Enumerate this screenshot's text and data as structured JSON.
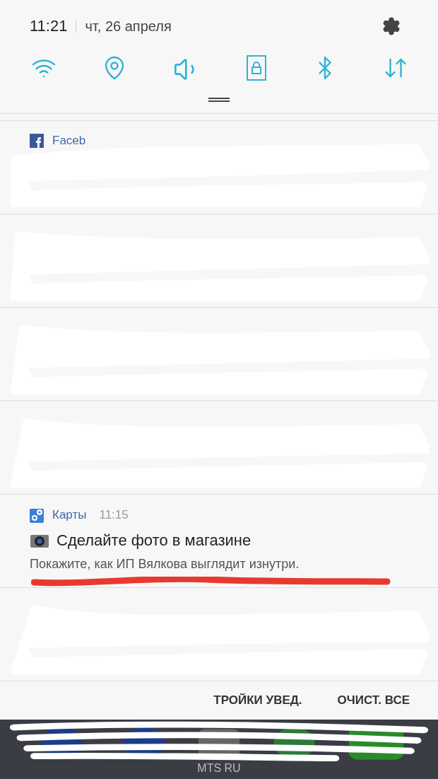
{
  "status": {
    "time": "11:21",
    "date": "чт, 26 апреля"
  },
  "quick_toggles": [
    {
      "kind": "wifi",
      "on": true
    },
    {
      "kind": "location",
      "on": true
    },
    {
      "kind": "sound",
      "on": true
    },
    {
      "kind": "rotation_lock",
      "on": true
    },
    {
      "kind": "bluetooth",
      "on": true
    },
    {
      "kind": "data",
      "on": true
    }
  ],
  "notifications": [
    {
      "kind": "redacted",
      "app": "Faceb"
    },
    {
      "kind": "redacted"
    },
    {
      "kind": "redacted"
    },
    {
      "kind": "redacted"
    },
    {
      "kind": "message",
      "app": "Карты",
      "time": "11:15",
      "title": "Сделайте фото в магазине",
      "body": "Покажите, как ИП Вялкова выглядит изнутри.",
      "underlined": true
    },
    {
      "kind": "redacted"
    }
  ],
  "actions": [
    "ТРОЙКИ УВЕД.",
    "ОЧИСТ. ВСЕ"
  ],
  "dock": {
    "carrier": "MTS RU"
  }
}
